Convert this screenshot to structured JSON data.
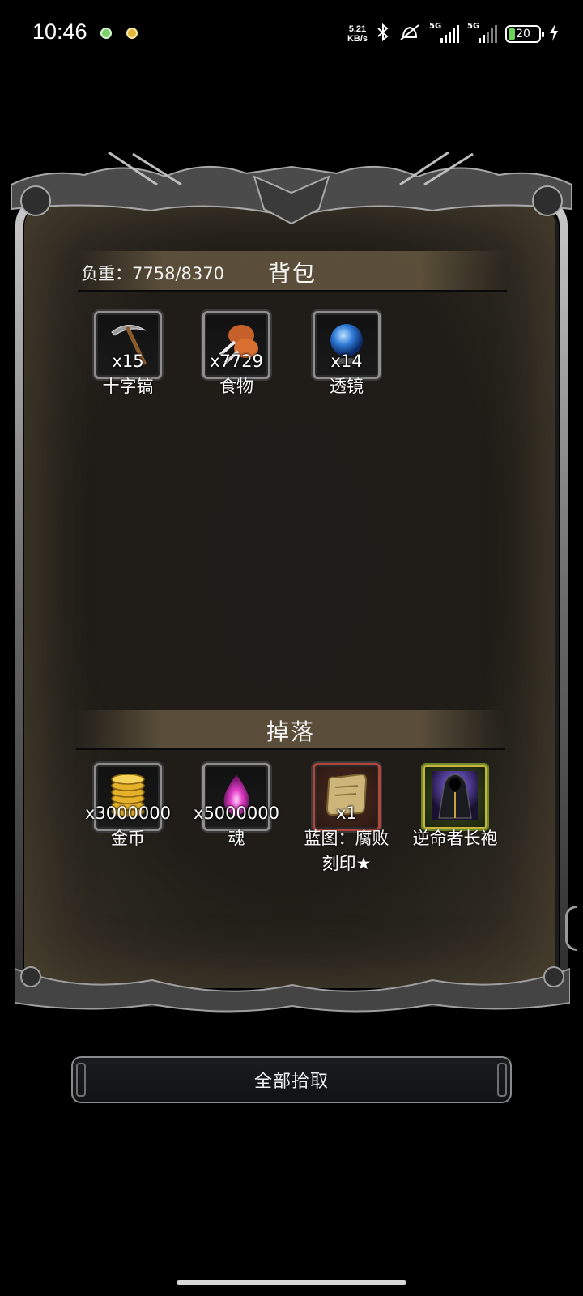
{
  "status_bar": {
    "time": "10:46",
    "net_speed": "5.21",
    "net_unit": "KB/s",
    "signal1": "5G",
    "signal2": "5G",
    "battery": "20",
    "icons": [
      "wechat-notification-icon",
      "app-notification-icon",
      "bluetooth-icon",
      "mute-icon",
      "charging-icon"
    ]
  },
  "backpack": {
    "weight_label": "负重：7758/8370",
    "title": "背包",
    "items": [
      {
        "icon": "pickaxe-icon",
        "qty": "x15",
        "name": "十字镐"
      },
      {
        "icon": "meat-icon",
        "qty": "x7729",
        "name": "食物"
      },
      {
        "icon": "crystal-orb-icon",
        "qty": "x14",
        "name": "透镜"
      }
    ]
  },
  "drops": {
    "title": "掉落",
    "items": [
      {
        "icon": "gold-coins-icon",
        "qty": "x3000000",
        "name": "金币"
      },
      {
        "icon": "soul-flame-icon",
        "qty": "x5000000",
        "name": "魂"
      },
      {
        "icon": "blueprint-scroll-icon",
        "qty": "x1",
        "name": "蓝图：腐败刻印★",
        "name_line1": "蓝图：腐败",
        "name_line2": "刻印★"
      },
      {
        "icon": "robe-icon",
        "qty": "",
        "name": "逆命者长袍"
      }
    ]
  },
  "actions": {
    "pickup_all": "全部拾取"
  },
  "colors": {
    "panel_bg": "#201d18",
    "header_band": "#6e5f46",
    "slot_border": "#8e8e8e",
    "rare_border": "#b5453a",
    "epic_border": "#6e8a2a"
  }
}
